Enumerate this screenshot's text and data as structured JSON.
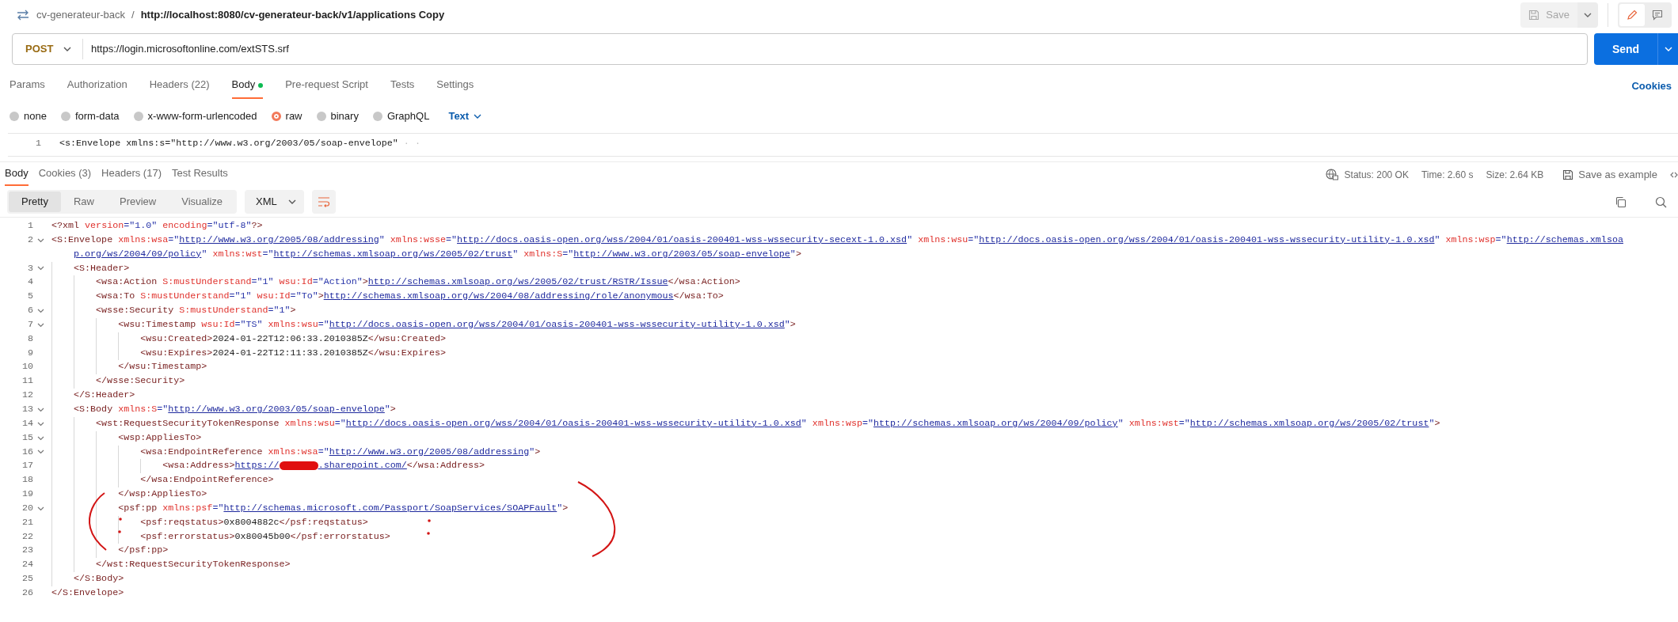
{
  "breadcrumb": {
    "collection": "cv-generateur-back",
    "separator": "/",
    "request": "http://localhost:8080/cv-generateur-back/v1/applications Copy"
  },
  "header_actions": {
    "save": "Save",
    "save_disabled": true,
    "modes": [
      {
        "kind": "edit",
        "selected": true
      },
      {
        "kind": "comment",
        "selected": false
      }
    ]
  },
  "request": {
    "method": "POST",
    "url": "https://login.microsoftonline.com/extSTS.srf",
    "send": "Send"
  },
  "request_tabs": [
    {
      "label": "Params",
      "selected": false,
      "has_content": false
    },
    {
      "label": "Authorization",
      "selected": false,
      "has_content": false
    },
    {
      "label": "Headers (22)",
      "selected": false,
      "has_content": false
    },
    {
      "label": "Body",
      "selected": true,
      "has_content": true
    },
    {
      "label": "Pre-request Script",
      "selected": false,
      "has_content": false
    },
    {
      "label": "Tests",
      "selected": false,
      "has_content": false
    },
    {
      "label": "Settings",
      "selected": false,
      "has_content": false
    }
  ],
  "cookies_link": "Cookies",
  "body_types": [
    {
      "label": "none",
      "selected": false
    },
    {
      "label": "form-data",
      "selected": false
    },
    {
      "label": "x-www-form-urlencoded",
      "selected": false
    },
    {
      "label": "raw",
      "selected": true
    },
    {
      "label": "binary",
      "selected": false
    },
    {
      "label": "GraphQL",
      "selected": false
    }
  ],
  "body_format": "Text",
  "request_editor": {
    "lines": [
      {
        "number": "1",
        "tokens": [
          {
            "kind": "plain",
            "text": "<s:Envelope xmlns:s=\"http://www.w3.org/2003/05/soap-envelope\""
          },
          {
            "kind": "whitespace",
            "text": " · ·"
          }
        ]
      }
    ]
  },
  "response_tabs": [
    {
      "label": "Body",
      "selected": true
    },
    {
      "label": "Cookies (3)",
      "selected": false
    },
    {
      "label": "Headers (17)",
      "selected": false
    },
    {
      "label": "Test Results",
      "selected": false
    }
  ],
  "response_meta": {
    "status": "Status: 200 OK",
    "time": "Time: 2.60 s",
    "size": "Size: 2.64 KB",
    "save_example": "Save as example"
  },
  "view_modes": [
    {
      "label": "Pretty",
      "selected": true
    },
    {
      "label": "Raw",
      "selected": false
    },
    {
      "label": "Preview",
      "selected": false
    },
    {
      "label": "Visualize",
      "selected": false
    }
  ],
  "language": "XML",
  "wrap_lines": true,
  "response_body": {
    "lines": [
      {
        "number": "1",
        "foldable": false,
        "tokens": [
          {
            "kind": "tag",
            "text": "<?xml"
          },
          {
            "kind": "attr",
            "text": " version"
          },
          {
            "kind": "punct",
            "text": "="
          },
          {
            "kind": "value",
            "text": "\"1.0\""
          },
          {
            "kind": "attr",
            "text": " encoding"
          },
          {
            "kind": "punct",
            "text": "="
          },
          {
            "kind": "value",
            "text": "\"utf-8\""
          },
          {
            "kind": "tag",
            "text": "?>"
          }
        ]
      },
      {
        "number": "2",
        "foldable": true,
        "tokens": [
          {
            "kind": "tag",
            "text": "<S:Envelope"
          },
          {
            "kind": "attr",
            "text": " xmlns:wsa"
          },
          {
            "kind": "punct",
            "text": "=\""
          },
          {
            "kind": "link",
            "text": "http://www.w3.org/2005/08/addressing"
          },
          {
            "kind": "punct",
            "text": "\""
          },
          {
            "kind": "attr",
            "text": " xmlns:wsse"
          },
          {
            "kind": "punct",
            "text": "=\""
          },
          {
            "kind": "link",
            "text": "http://docs.oasis-open.org/wss/2004/01/oasis-200401-wss-wssecurity-secext-1.0.xsd"
          },
          {
            "kind": "punct",
            "text": "\""
          },
          {
            "kind": "attr",
            "text": " xmlns:wsu"
          },
          {
            "kind": "punct",
            "text": "=\""
          },
          {
            "kind": "link",
            "text": "http://docs.oasis-open.org/wss/2004/01/oasis-200401-wss-wssecurity-utility-1.0.xsd"
          },
          {
            "kind": "punct",
            "text": "\""
          },
          {
            "kind": "attr",
            "text": " xmlns:wsp"
          },
          {
            "kind": "punct",
            "text": "=\""
          },
          {
            "kind": "link",
            "text": "http://schemas.xmlsoap.org/ws/2004/09/policy"
          },
          {
            "kind": "punct",
            "text": "\""
          },
          {
            "kind": "attr",
            "text": " xmlns:wst"
          },
          {
            "kind": "punct",
            "text": "=\""
          },
          {
            "kind": "link",
            "text": "http://schemas.xmlsoap.org/ws/2005/02/trust"
          },
          {
            "kind": "punct",
            "text": "\""
          },
          {
            "kind": "attr",
            "text": " xmlns:S"
          },
          {
            "kind": "punct",
            "text": "=\""
          },
          {
            "kind": "link",
            "text": "http://www.w3.org/2003/05/soap-envelope"
          },
          {
            "kind": "punct",
            "text": "\""
          },
          {
            "kind": "tag",
            "text": ">"
          }
        ]
      },
      {
        "number": "3",
        "foldable": true,
        "tokens": [
          {
            "kind": "tag",
            "text": "    <S:Header>"
          }
        ]
      },
      {
        "number": "4",
        "foldable": false,
        "tokens": [
          {
            "kind": "tag",
            "text": "        <wsa:Action"
          },
          {
            "kind": "attr",
            "text": " S:mustUnderstand"
          },
          {
            "kind": "punct",
            "text": "="
          },
          {
            "kind": "value",
            "text": "\"1\""
          },
          {
            "kind": "attr",
            "text": " wsu:Id"
          },
          {
            "kind": "punct",
            "text": "="
          },
          {
            "kind": "value",
            "text": "\"Action\""
          },
          {
            "kind": "tag",
            "text": ">"
          },
          {
            "kind": "link",
            "text": "http://schemas.xmlsoap.org/ws/2005/02/trust/RSTR/Issue"
          },
          {
            "kind": "tag",
            "text": "</wsa:Action>"
          }
        ]
      },
      {
        "number": "5",
        "foldable": false,
        "tokens": [
          {
            "kind": "tag",
            "text": "        <wsa:To"
          },
          {
            "kind": "attr",
            "text": " S:mustUnderstand"
          },
          {
            "kind": "punct",
            "text": "="
          },
          {
            "kind": "value",
            "text": "\"1\""
          },
          {
            "kind": "attr",
            "text": " wsu:Id"
          },
          {
            "kind": "punct",
            "text": "="
          },
          {
            "kind": "value",
            "text": "\"To\""
          },
          {
            "kind": "tag",
            "text": ">"
          },
          {
            "kind": "link",
            "text": "http://schemas.xmlsoap.org/ws/2004/08/addressing/role/anonymous"
          },
          {
            "kind": "tag",
            "text": "</wsa:To>"
          }
        ]
      },
      {
        "number": "6",
        "foldable": true,
        "tokens": [
          {
            "kind": "tag",
            "text": "        <wsse:Security"
          },
          {
            "kind": "attr",
            "text": " S:mustUnderstand"
          },
          {
            "kind": "punct",
            "text": "="
          },
          {
            "kind": "value",
            "text": "\"1\""
          },
          {
            "kind": "tag",
            "text": ">"
          }
        ]
      },
      {
        "number": "7",
        "foldable": true,
        "tokens": [
          {
            "kind": "tag",
            "text": "            <wsu:Timestamp"
          },
          {
            "kind": "attr",
            "text": " wsu:Id"
          },
          {
            "kind": "punct",
            "text": "="
          },
          {
            "kind": "value",
            "text": "\"TS\""
          },
          {
            "kind": "attr",
            "text": " xmlns:wsu"
          },
          {
            "kind": "punct",
            "text": "=\""
          },
          {
            "kind": "link",
            "text": "http://docs.oasis-open.org/wss/2004/01/oasis-200401-wss-wssecurity-utility-1.0.xsd"
          },
          {
            "kind": "punct",
            "text": "\""
          },
          {
            "kind": "tag",
            "text": ">"
          }
        ]
      },
      {
        "number": "8",
        "foldable": false,
        "tokens": [
          {
            "kind": "tag",
            "text": "                <wsu:Created>"
          },
          {
            "kind": "text",
            "text": "2024-01-22T12:06:33.2010385Z"
          },
          {
            "kind": "tag",
            "text": "</wsu:Created>"
          }
        ]
      },
      {
        "number": "9",
        "foldable": false,
        "tokens": [
          {
            "kind": "tag",
            "text": "                <wsu:Expires>"
          },
          {
            "kind": "text",
            "text": "2024-01-22T12:11:33.2010385Z"
          },
          {
            "kind": "tag",
            "text": "</wsu:Expires>"
          }
        ]
      },
      {
        "number": "10",
        "foldable": false,
        "tokens": [
          {
            "kind": "tag",
            "text": "            </wsu:Timestamp>"
          }
        ]
      },
      {
        "number": "11",
        "foldable": false,
        "tokens": [
          {
            "kind": "tag",
            "text": "        </wsse:Security>"
          }
        ]
      },
      {
        "number": "12",
        "foldable": false,
        "tokens": [
          {
            "kind": "tag",
            "text": "    </S:Header>"
          }
        ]
      },
      {
        "number": "13",
        "foldable": true,
        "tokens": [
          {
            "kind": "tag",
            "text": "    <S:Body"
          },
          {
            "kind": "attr",
            "text": " xmlns:S"
          },
          {
            "kind": "punct",
            "text": "=\""
          },
          {
            "kind": "link",
            "text": "http://www.w3.org/2003/05/soap-envelope"
          },
          {
            "kind": "punct",
            "text": "\""
          },
          {
            "kind": "tag",
            "text": ">"
          }
        ]
      },
      {
        "number": "14",
        "foldable": true,
        "tokens": [
          {
            "kind": "tag",
            "text": "        <wst:RequestSecurityTokenResponse"
          },
          {
            "kind": "attr",
            "text": " xmlns:wsu"
          },
          {
            "kind": "punct",
            "text": "=\""
          },
          {
            "kind": "link",
            "text": "http://docs.oasis-open.org/wss/2004/01/oasis-200401-wss-wssecurity-utility-1.0.xsd"
          },
          {
            "kind": "punct",
            "text": "\""
          },
          {
            "kind": "attr",
            "text": " xmlns:wsp"
          },
          {
            "kind": "punct",
            "text": "=\""
          },
          {
            "kind": "link",
            "text": "http://schemas.xmlsoap.org/ws/2004/09/policy"
          },
          {
            "kind": "punct",
            "text": "\""
          },
          {
            "kind": "attr",
            "text": " xmlns:wst"
          },
          {
            "kind": "punct",
            "text": "=\""
          },
          {
            "kind": "link",
            "text": "http://schemas.xmlsoap.org/ws/2005/02/trust"
          },
          {
            "kind": "punct",
            "text": "\""
          },
          {
            "kind": "tag",
            "text": ">"
          }
        ]
      },
      {
        "number": "15",
        "foldable": true,
        "tokens": [
          {
            "kind": "tag",
            "text": "            <wsp:AppliesTo>"
          }
        ]
      },
      {
        "number": "16",
        "foldable": true,
        "tokens": [
          {
            "kind": "tag",
            "text": "                <wsa:EndpointReference"
          },
          {
            "kind": "attr",
            "text": " xmlns:wsa"
          },
          {
            "kind": "punct",
            "text": "=\""
          },
          {
            "kind": "link",
            "text": "http://www.w3.org/2005/08/addressing"
          },
          {
            "kind": "punct",
            "text": "\""
          },
          {
            "kind": "tag",
            "text": ">"
          }
        ]
      },
      {
        "number": "17",
        "foldable": false,
        "tokens": [
          {
            "kind": "tag",
            "text": "                    <wsa:Address>"
          },
          {
            "kind": "link",
            "text": "https://"
          },
          {
            "kind": "redaction"
          },
          {
            "kind": "link",
            "text": ".sharepoint.com/"
          },
          {
            "kind": "tag",
            "text": "</wsa:Address>"
          }
        ]
      },
      {
        "number": "18",
        "foldable": false,
        "tokens": [
          {
            "kind": "tag",
            "text": "                </wsa:EndpointReference>"
          }
        ]
      },
      {
        "number": "19",
        "foldable": false,
        "tokens": [
          {
            "kind": "tag",
            "text": "            </wsp:AppliesTo>"
          }
        ]
      },
      {
        "number": "20",
        "foldable": true,
        "tokens": [
          {
            "kind": "tag",
            "text": "            <psf:pp"
          },
          {
            "kind": "attr",
            "text": " xmlns:psf"
          },
          {
            "kind": "punct",
            "text": "=\""
          },
          {
            "kind": "link",
            "text": "http://schemas.microsoft.com/Passport/SoapServices/SOAPFault"
          },
          {
            "kind": "punct",
            "text": "\""
          },
          {
            "kind": "tag",
            "text": ">"
          }
        ]
      },
      {
        "number": "21",
        "foldable": false,
        "tokens": [
          {
            "kind": "tag",
            "text": "                <psf:reqstatus>"
          },
          {
            "kind": "text",
            "text": "0x8004882c"
          },
          {
            "kind": "tag",
            "text": "</psf:reqstatus>"
          }
        ]
      },
      {
        "number": "22",
        "foldable": false,
        "tokens": [
          {
            "kind": "tag",
            "text": "                <psf:errorstatus>"
          },
          {
            "kind": "text",
            "text": "0x80045b00"
          },
          {
            "kind": "tag",
            "text": "</psf:errorstatus>"
          }
        ]
      },
      {
        "number": "23",
        "foldable": false,
        "tokens": [
          {
            "kind": "tag",
            "text": "            </psf:pp>"
          }
        ]
      },
      {
        "number": "24",
        "foldable": false,
        "tokens": [
          {
            "kind": "tag",
            "text": "        </wst:RequestSecurityTokenResponse>"
          }
        ]
      },
      {
        "number": "25",
        "foldable": false,
        "tokens": [
          {
            "kind": "tag",
            "text": "    </S:Body>"
          }
        ]
      },
      {
        "number": "26",
        "foldable": false,
        "tokens": [
          {
            "kind": "tag",
            "text": "</S:Envelope>"
          }
        ]
      }
    ]
  },
  "annotations": [
    {
      "kind": "left-bracket"
    },
    {
      "kind": "dots"
    },
    {
      "kind": "dots"
    },
    {
      "kind": "right-bracket"
    }
  ]
}
